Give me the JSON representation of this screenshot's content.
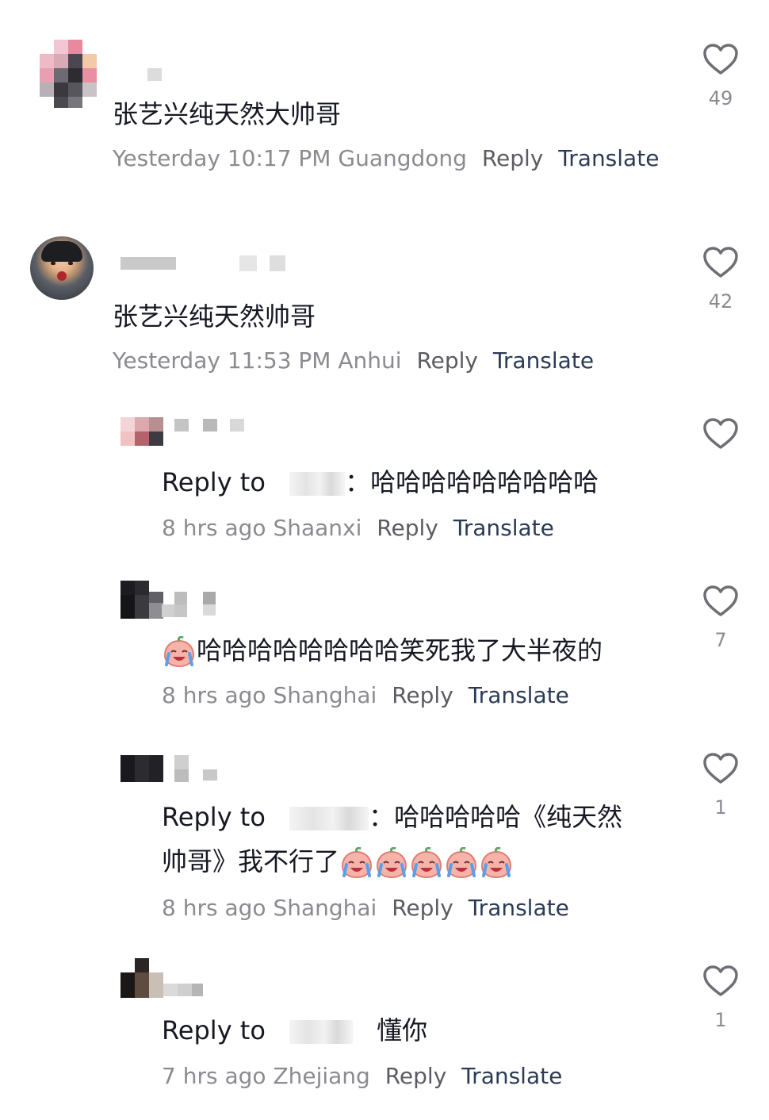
{
  "comments": [
    {
      "text": "张艺兴纯天然大帅哥",
      "time": "Yesterday 10:17 PM",
      "location": "Guangdong",
      "reply_label": "Reply",
      "translate_label": "Translate",
      "likes": "49"
    },
    {
      "text": "张艺兴纯天然帅哥",
      "time": "Yesterday 11:53 PM",
      "location": "Anhui",
      "reply_label": "Reply",
      "translate_label": "Translate",
      "likes": "42"
    },
    {
      "reply_to": "Reply to",
      "text": "哈哈哈哈哈哈哈哈哈",
      "time": "8 hrs ago",
      "location": "Shaanxi",
      "reply_label": "Reply",
      "translate_label": "Translate",
      "likes": ""
    },
    {
      "text": "哈哈哈哈哈哈哈哈笑死我了大半夜的",
      "time": "8 hrs ago",
      "location": "Shanghai",
      "reply_label": "Reply",
      "translate_label": "Translate",
      "likes": "7"
    },
    {
      "reply_to": "Reply to",
      "text_line1": "哈哈哈哈哈《纯天然",
      "text_line2": "帅哥》我不行了",
      "time": "8 hrs ago",
      "location": "Shanghai",
      "reply_label": "Reply",
      "translate_label": "Translate",
      "likes": "1"
    },
    {
      "reply_to": "Reply to",
      "text": "懂你",
      "time": "7 hrs ago",
      "location": "Zhejiang",
      "reply_label": "Reply",
      "translate_label": "Translate",
      "likes": "1"
    }
  ],
  "icons": {
    "like": "heart-outline-icon",
    "emoji": "crying-laughing-peach-emoji"
  },
  "colors": {
    "text": "#161823",
    "meta": "#8a8b91",
    "reply": "#5b5c63",
    "translate": "#2b3a55",
    "heart_stroke": "#6e6f75"
  }
}
